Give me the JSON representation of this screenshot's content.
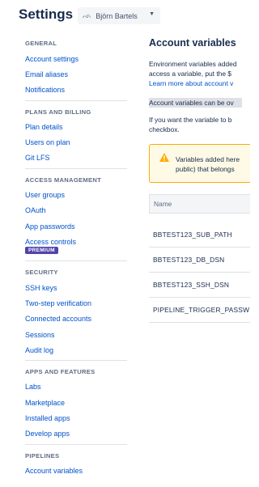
{
  "header": {
    "title": "Settings",
    "account_name": "Björn Bartels",
    "avatar_glyph": "ᨒ"
  },
  "sidebar": {
    "groups": [
      {
        "title": "GENERAL",
        "items": [
          "Account settings",
          "Email aliases",
          "Notifications"
        ]
      },
      {
        "title": "PLANS AND BILLING",
        "items": [
          "Plan details",
          "Users on plan",
          "Git LFS"
        ]
      },
      {
        "title": "ACCESS MANAGEMENT",
        "items": [
          "User groups",
          "OAuth",
          "App passwords",
          "Access controls"
        ],
        "badge": "PREMIUM"
      },
      {
        "title": "SECURITY",
        "items": [
          "SSH keys",
          "Two-step verification",
          "Connected accounts",
          "Sessions",
          "Audit log"
        ]
      },
      {
        "title": "APPS AND FEATURES",
        "items": [
          "Labs",
          "Marketplace",
          "Installed apps",
          "Develop apps"
        ]
      },
      {
        "title": "PIPELINES",
        "items": [
          "Account variables"
        ]
      }
    ]
  },
  "main": {
    "title": "Account variables",
    "intro_line1": "Environment variables added",
    "intro_line2": "access a variable, put the $",
    "learn_more": "Learn more about account v",
    "highlight": "Account variables can be ov",
    "secure_line1": "If you want the variable to b",
    "secure_line2": "checkbox.",
    "warning_line1": "Variables added here",
    "warning_line2": "public) that belongs",
    "table_header": "Name",
    "variables": [
      "BBTEST123_SUB_PATH",
      "BBTEST123_DB_DSN",
      "BBTEST123_SSH_DSN",
      "PIPELINE_TRIGGER_PASSW"
    ]
  },
  "colors": {
    "link": "#0052cc",
    "premium": "#5243aa",
    "warning_border": "#ffab00",
    "warning_icon": "#ffab00"
  }
}
